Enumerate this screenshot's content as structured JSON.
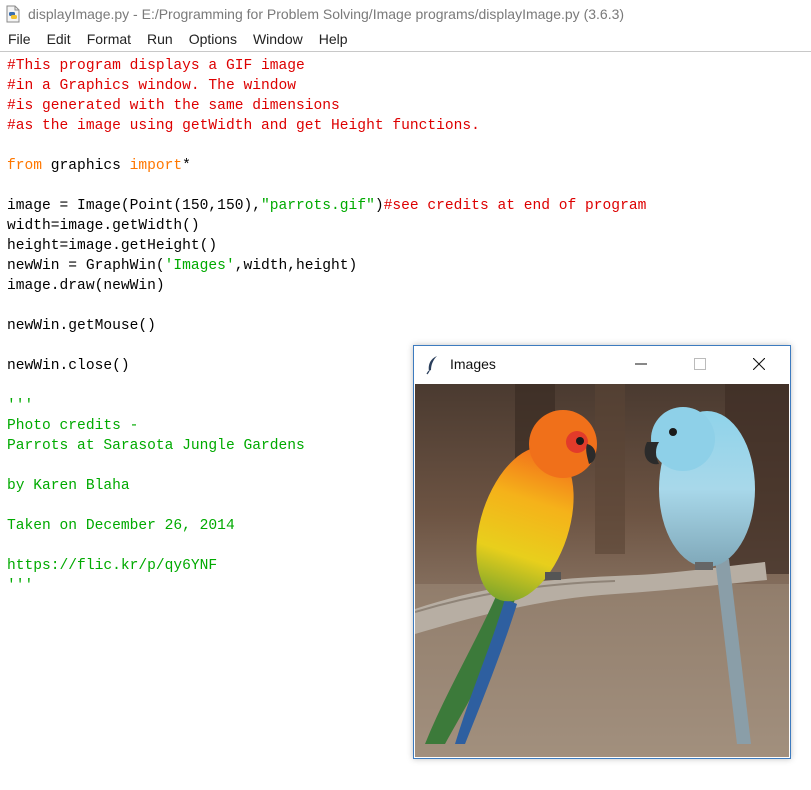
{
  "window": {
    "title": "displayImage.py - E:/Programming for Problem Solving/Image programs/displayImage.py (3.6.3)"
  },
  "menu": [
    "File",
    "Edit",
    "Format",
    "Run",
    "Options",
    "Window",
    "Help"
  ],
  "code_lines": [
    [
      {
        "t": "#This program displays a GIF image",
        "c": "comment"
      }
    ],
    [
      {
        "t": "#in a Graphics window. The window",
        "c": "comment"
      }
    ],
    [
      {
        "t": "#is generated with the same dimensions",
        "c": "comment"
      }
    ],
    [
      {
        "t": "#as the image using getWidth and get Height functions.",
        "c": "comment"
      }
    ],
    [],
    [
      {
        "t": "from",
        "c": "kw"
      },
      {
        "t": " graphics ",
        "c": "plain"
      },
      {
        "t": "import",
        "c": "kw"
      },
      {
        "t": "*",
        "c": "plain"
      }
    ],
    [],
    [
      {
        "t": "image = Image(Point(150,150),",
        "c": "plain"
      },
      {
        "t": "\"parrots.gif\"",
        "c": "str"
      },
      {
        "t": ")",
        "c": "plain"
      },
      {
        "t": "#see credits at end of program",
        "c": "comment"
      }
    ],
    [
      {
        "t": "width=image.getWidth()",
        "c": "plain"
      }
    ],
    [
      {
        "t": "height=image.getHeight()",
        "c": "plain"
      }
    ],
    [
      {
        "t": "newWin = GraphWin(",
        "c": "plain"
      },
      {
        "t": "'Images'",
        "c": "str"
      },
      {
        "t": ",width,height)",
        "c": "plain"
      }
    ],
    [
      {
        "t": "image.draw(newWin)",
        "c": "plain"
      }
    ],
    [],
    [
      {
        "t": "newWin.getMouse()",
        "c": "plain"
      }
    ],
    [],
    [
      {
        "t": "newWin.close()",
        "c": "plain"
      }
    ],
    [],
    [
      {
        "t": "'''",
        "c": "str"
      }
    ],
    [
      {
        "t": "Photo credits -",
        "c": "str"
      }
    ],
    [
      {
        "t": "Parrots at Sarasota Jungle Gardens",
        "c": "str"
      }
    ],
    [],
    [
      {
        "t": "by Karen Blaha",
        "c": "str"
      }
    ],
    [],
    [
      {
        "t": "Taken on December 26, 2014",
        "c": "str"
      }
    ],
    [],
    [
      {
        "t": "https://flic.kr/p/qy6YNF",
        "c": "str"
      }
    ],
    [
      {
        "t": "'''",
        "c": "str"
      }
    ]
  ],
  "image_window": {
    "title": "Images",
    "icon": "feather-icon",
    "controls": [
      "minimize-icon",
      "maximize-icon",
      "close-icon"
    ]
  },
  "colors": {
    "comment": "#dd0000",
    "keyword": "#ff7700",
    "string": "#00aa00",
    "window_border": "#3d7bbf"
  }
}
